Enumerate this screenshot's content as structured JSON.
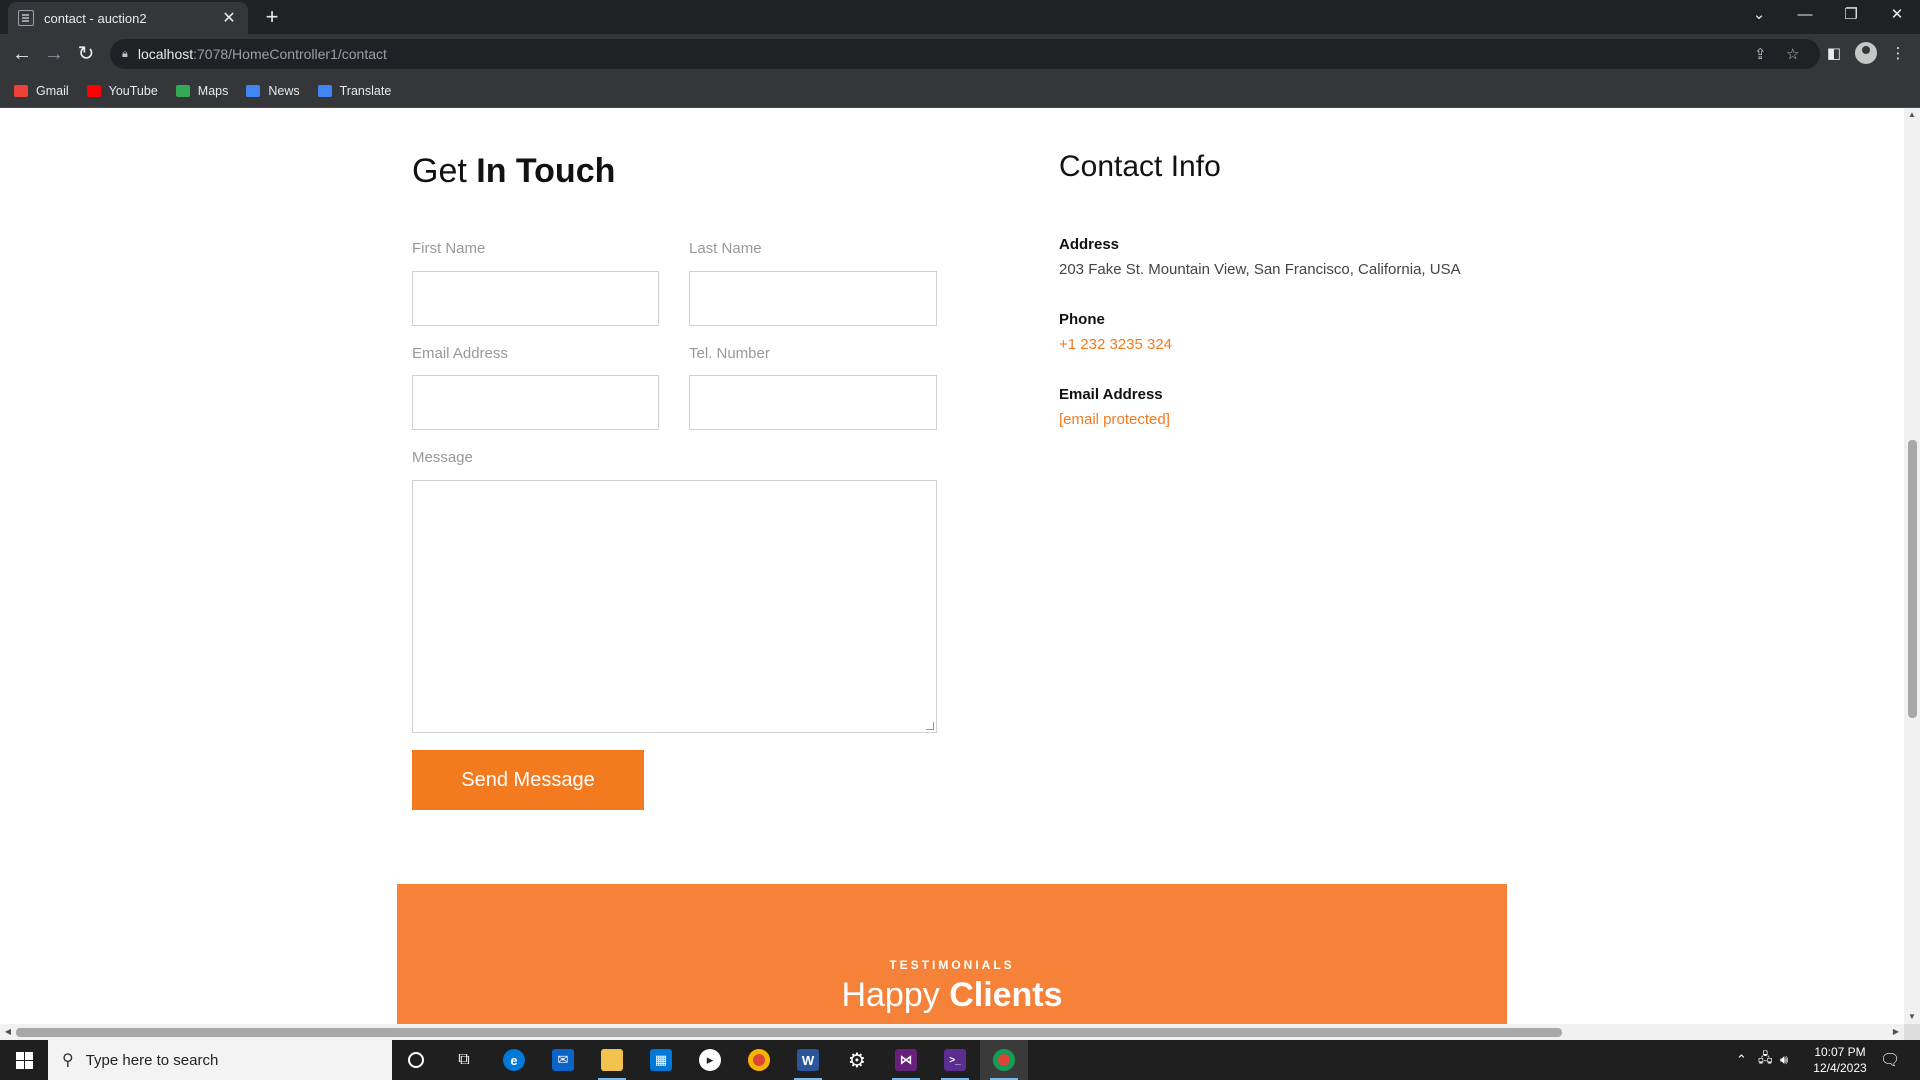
{
  "browser": {
    "tab_title": "contact - auction2",
    "tab_close": "✕",
    "new_tab": "+",
    "url_host": "localhost",
    "url_path": ":7078/HomeController1/contact",
    "bookmarks": [
      {
        "label": "Gmail",
        "color": "#ea4335"
      },
      {
        "label": "YouTube",
        "color": "#ff0000"
      },
      {
        "label": "Maps",
        "color": "#34a853"
      },
      {
        "label": "News",
        "color": "#4285f4"
      },
      {
        "label": "Translate",
        "color": "#4285f4"
      }
    ]
  },
  "contact_form": {
    "heading_light": "Get ",
    "heading_bold": "In Touch",
    "first_name_label": "First Name",
    "last_name_label": "Last Name",
    "email_label": "Email Address",
    "tel_label": "Tel. Number",
    "message_label": "Message",
    "first_name_value": "",
    "last_name_value": "",
    "email_value": "",
    "tel_value": "",
    "message_value": "",
    "send_label": "Send Message"
  },
  "contact_info": {
    "title": "Contact Info",
    "address_label": "Address",
    "address_value": "203 Fake St. Mountain View, San Francisco, California, USA",
    "phone_label": "Phone",
    "phone_value": "+1 232 3235 324",
    "email_label": "Email Address",
    "email_value": "[email protected]"
  },
  "testimonials": {
    "kicker": "TESTIMONIALS",
    "heading_light": "Happy ",
    "heading_bold": "Clients"
  },
  "taskbar": {
    "search_placeholder": "Type here to search",
    "time": "10:07 PM",
    "date": "12/4/2023"
  },
  "colors": {
    "accent": "#f47a20",
    "testimonial_bg": "#f58238"
  }
}
